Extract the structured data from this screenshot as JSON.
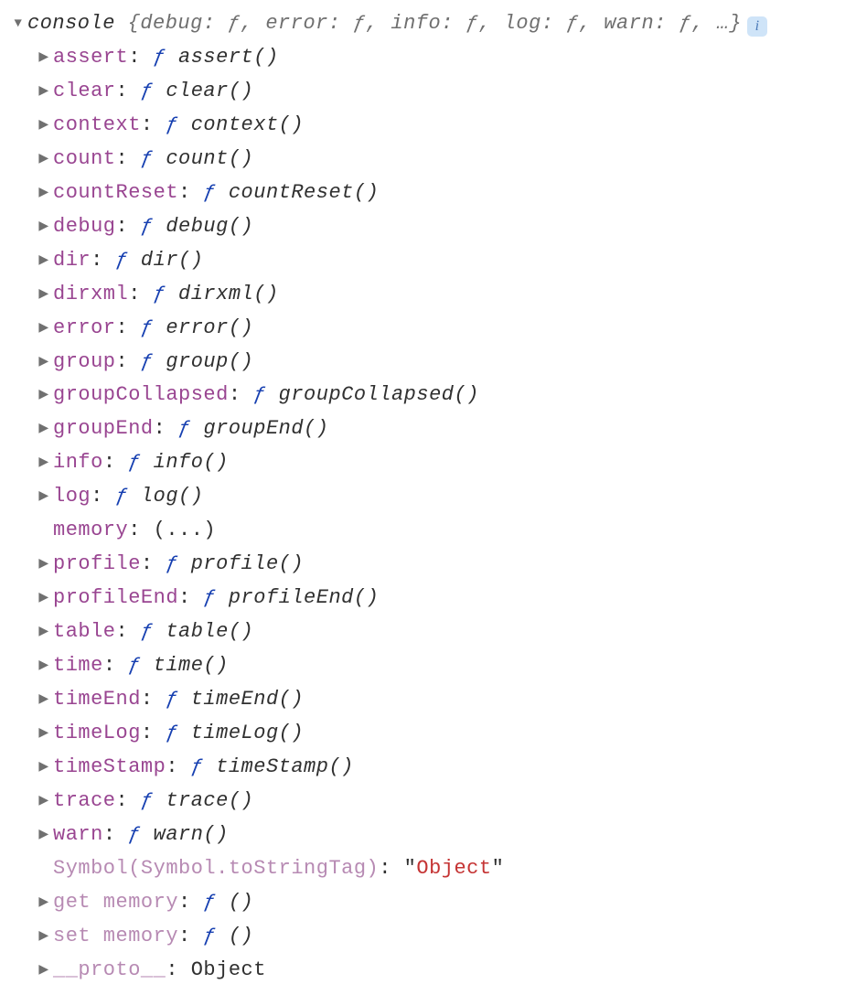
{
  "root": {
    "name": "console",
    "summary_prefix": " {",
    "summary_suffix": ", …}",
    "summary_items": [
      {
        "key": "debug",
        "val": "ƒ"
      },
      {
        "key": "error",
        "val": "ƒ"
      },
      {
        "key": "info",
        "val": "ƒ"
      },
      {
        "key": "log",
        "val": "ƒ"
      },
      {
        "key": "warn",
        "val": "ƒ"
      }
    ],
    "info_icon": "i"
  },
  "props": [
    {
      "key": "assert",
      "kind": "fn",
      "fn": "assert()"
    },
    {
      "key": "clear",
      "kind": "fn",
      "fn": "clear()"
    },
    {
      "key": "context",
      "kind": "fn",
      "fn": "context()"
    },
    {
      "key": "count",
      "kind": "fn",
      "fn": "count()"
    },
    {
      "key": "countReset",
      "kind": "fn",
      "fn": "countReset()"
    },
    {
      "key": "debug",
      "kind": "fn",
      "fn": "debug()"
    },
    {
      "key": "dir",
      "kind": "fn",
      "fn": "dir()"
    },
    {
      "key": "dirxml",
      "kind": "fn",
      "fn": "dirxml()"
    },
    {
      "key": "error",
      "kind": "fn",
      "fn": "error()"
    },
    {
      "key": "group",
      "kind": "fn",
      "fn": "group()"
    },
    {
      "key": "groupCollapsed",
      "kind": "fn",
      "fn": "groupCollapsed()"
    },
    {
      "key": "groupEnd",
      "kind": "fn",
      "fn": "groupEnd()"
    },
    {
      "key": "info",
      "kind": "fn",
      "fn": "info()"
    },
    {
      "key": "log",
      "kind": "fn",
      "fn": "log()"
    },
    {
      "key": "memory",
      "kind": "ellipsis",
      "text": "(...)",
      "noarrow": true
    },
    {
      "key": "profile",
      "kind": "fn",
      "fn": "profile()"
    },
    {
      "key": "profileEnd",
      "kind": "fn",
      "fn": "profileEnd()"
    },
    {
      "key": "table",
      "kind": "fn",
      "fn": "table()"
    },
    {
      "key": "time",
      "kind": "fn",
      "fn": "time()"
    },
    {
      "key": "timeEnd",
      "kind": "fn",
      "fn": "timeEnd()"
    },
    {
      "key": "timeLog",
      "kind": "fn",
      "fn": "timeLog()"
    },
    {
      "key": "timeStamp",
      "kind": "fn",
      "fn": "timeStamp()"
    },
    {
      "key": "trace",
      "kind": "fn",
      "fn": "trace()"
    },
    {
      "key": "warn",
      "kind": "fn",
      "fn": "warn()"
    },
    {
      "key": "Symbol(Symbol.toStringTag)",
      "kind": "string",
      "str": "Object",
      "noarrow": true,
      "dim": true
    },
    {
      "key": "get memory",
      "kind": "fn",
      "fn": "()",
      "dim": true
    },
    {
      "key": "set memory",
      "kind": "fn",
      "fn": "()",
      "dim": true
    },
    {
      "key": "__proto__",
      "kind": "plain",
      "text": "Object",
      "dim": true
    }
  ],
  "glyphs": {
    "expanded": "▼",
    "collapsed": "▶",
    "fsymbol": "ƒ"
  }
}
